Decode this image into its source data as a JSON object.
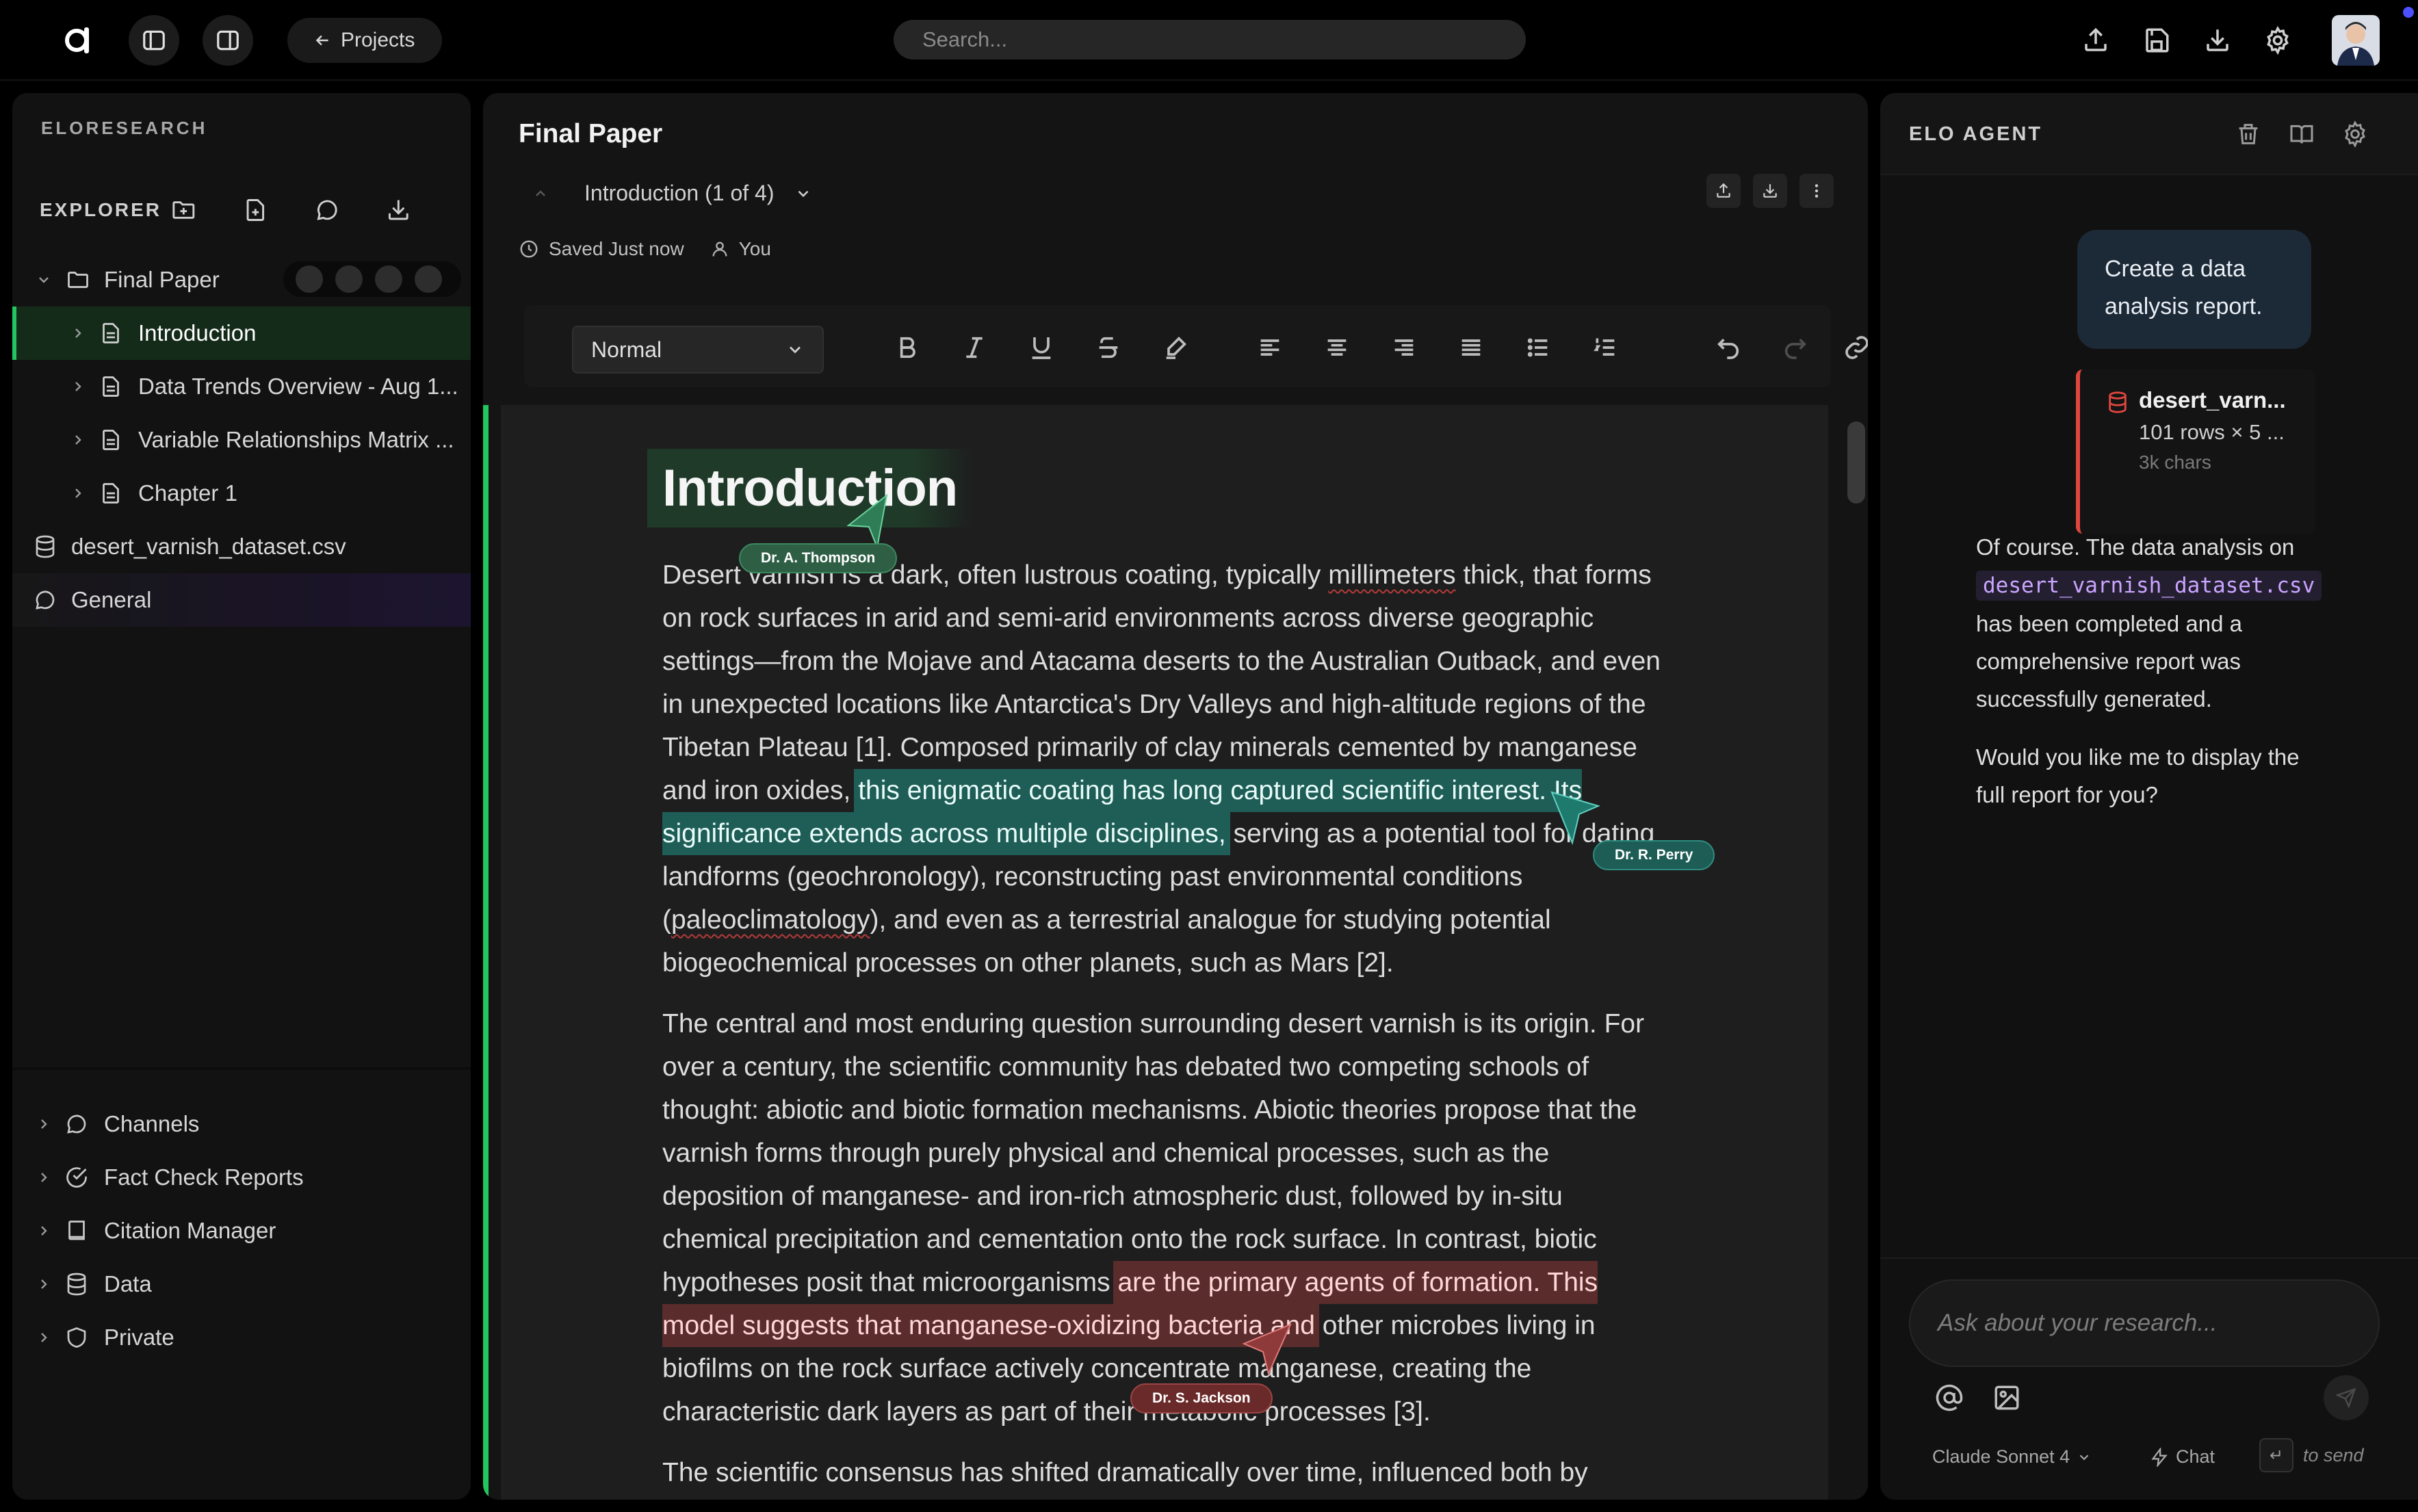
{
  "topbar": {
    "projects_label": "Projects",
    "search_placeholder": "Search..."
  },
  "sidebar": {
    "brand": "ELORESEARCH",
    "explorer_title": "EXPLORER",
    "tree": {
      "root": "Final Paper",
      "children": [
        "Introduction",
        "Data Trends Overview - Aug 1...",
        "Variable Relationships Matrix ...",
        "Chapter 1"
      ],
      "dataset_file": "desert_varnish_dataset.csv",
      "general": "General"
    },
    "sections": [
      "Channels",
      "Fact Check Reports",
      "Citation Manager",
      "Data",
      "Private"
    ]
  },
  "editor": {
    "doc_title": "Final Paper",
    "section_label": "Introduction (1 of 4)",
    "saved_status": "Saved Just now",
    "saved_by": "You",
    "style_select": "Normal",
    "heading": "Introduction",
    "p1": {
      "a": "Desert ",
      "b": "varnish is a dark, often lustrous coating, typically ",
      "c": "millimeters",
      "d": " thick, that forms on rock surfaces in arid and semi-arid environments across diverse geographic settings—from the Mojave and Atacama deserts to the Australian Outback, and even in unexpected locations like Antarctica's Dry Valleys and high-altitude regions of the Tibetan Plateau [1]. Composed primarily of clay minerals cemented by manganese and iron oxides, ",
      "hl": "this enigmatic coating has long captured scientific interest. Its significance extends across multiple disciplines,",
      "e": " serving as a potential tool for dating landforms (geochronology), reconstructing past environmental conditions (",
      "f": "paleoclimatology",
      "g": "), and even as a terrestrial analogue for studying potential biogeochemical processes on other planets, such as Mars [2]."
    },
    "p2": {
      "a": "The central and most enduring question surrounding desert varnish is its origin. For over a century, the scientific community has debated two competing schools of thought: abiotic and biotic formation mechanisms. Abiotic theories propose that the varnish forms through purely physical and chemical processes, such as the deposition of manganese- and iron-rich atmospheric dust, followed by in-situ chemical precipitation and cementation onto the rock surface. In contrast, biotic hypotheses posit that microorganisms ",
      "hl": "are the primary agents of formation. This model suggests that manganese-oxidizing bacteria and",
      "b": " other microbes living in biofilms on the rock surface actively concentrate manganese, creating the characteristic dark layers as part of their metabolic processes [3]."
    },
    "p3": "The scientific consensus has shifted dramatically over time, influenced both by",
    "collaborators": [
      "Dr. A. Thompson",
      "Dr. R. Perry",
      "Dr. S. Jackson"
    ],
    "collaborator_colors": [
      "#2e7d57",
      "#1f7a6e",
      "#8f3a3a"
    ]
  },
  "agent": {
    "title": "ELO AGENT",
    "user_message": "Create a data analysis report.",
    "attachment": {
      "name": "desert_varn...",
      "meta": "101 rows × 5 ...",
      "size": "3k chars"
    },
    "reply_a": "Of course. The data analysis on ",
    "reply_code": "desert_varnish_dataset.csv",
    "reply_b": " has been completed and a comprehensive report was successfully generated.",
    "reply_q": "Would you like me to display the full report for you?",
    "input_placeholder": "Ask about your research...",
    "model": "Claude Sonnet 4",
    "mode": "Chat",
    "send_hint": "to send"
  },
  "icons": [
    "app-logo-icon",
    "sidebar-toggle-icon",
    "split-view-icon",
    "arrow-left-icon",
    "upload-icon",
    "save-icon",
    "download-icon",
    "gear-icon",
    "folder-icon",
    "file-icon",
    "database-icon",
    "chat-icon",
    "check-circle-icon",
    "book-icon",
    "shield-icon",
    "trash-icon",
    "at-icon",
    "image-icon",
    "send-icon",
    "bolt-icon",
    "clock-icon",
    "user-icon"
  ],
  "colors": {
    "accent": "#22c55e",
    "teal_highlight": "#1f5d57",
    "red_highlight": "#5a2c2c",
    "code": "#c9a4ff",
    "attachment": "#e0463e"
  }
}
